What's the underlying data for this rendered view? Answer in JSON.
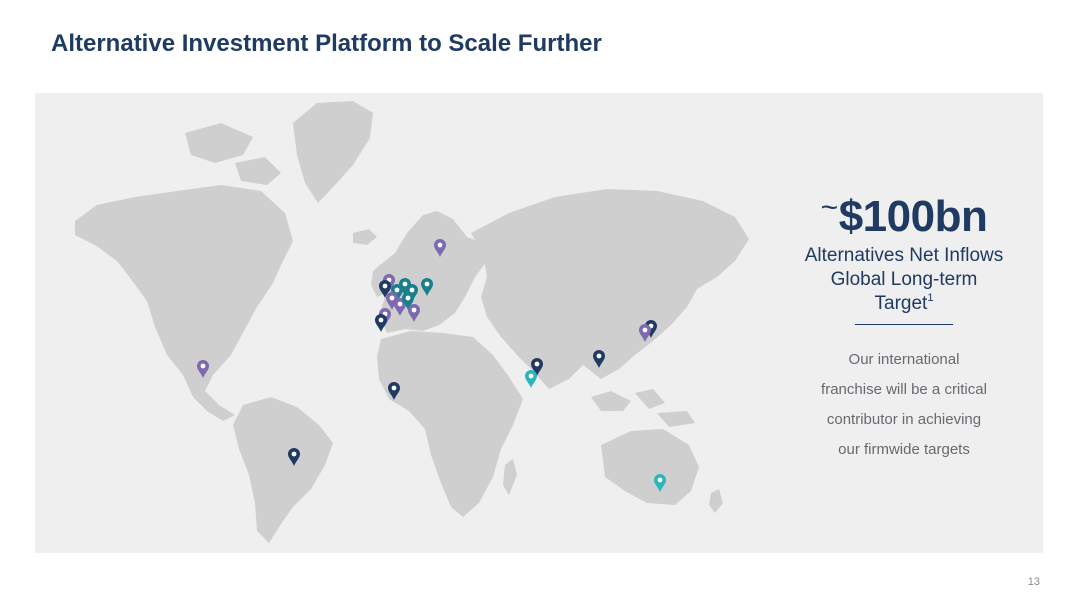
{
  "slide": {
    "title": "Alternative Investment Platform to Scale Further",
    "page_number": "13"
  },
  "callout": {
    "tilde": "~",
    "value": "$100bn",
    "line1": "Alternatives Net Inflows",
    "line2": "Global Long-term",
    "line3": "Target",
    "footnote_marker": "1",
    "body_lines": [
      "Our international",
      "franchise will be a critical",
      "contributor in achieving",
      "our firmwide targets"
    ]
  },
  "map": {
    "land_color": "#cfcfcf",
    "background_color": "#efefef",
    "pin_colors": {
      "navy": "#1f3a63",
      "teal": "#1a7f8c",
      "purple": "#7c69b0",
      "cyan": "#2bb6bf"
    },
    "pin_icon": "map-pin-icon"
  }
}
